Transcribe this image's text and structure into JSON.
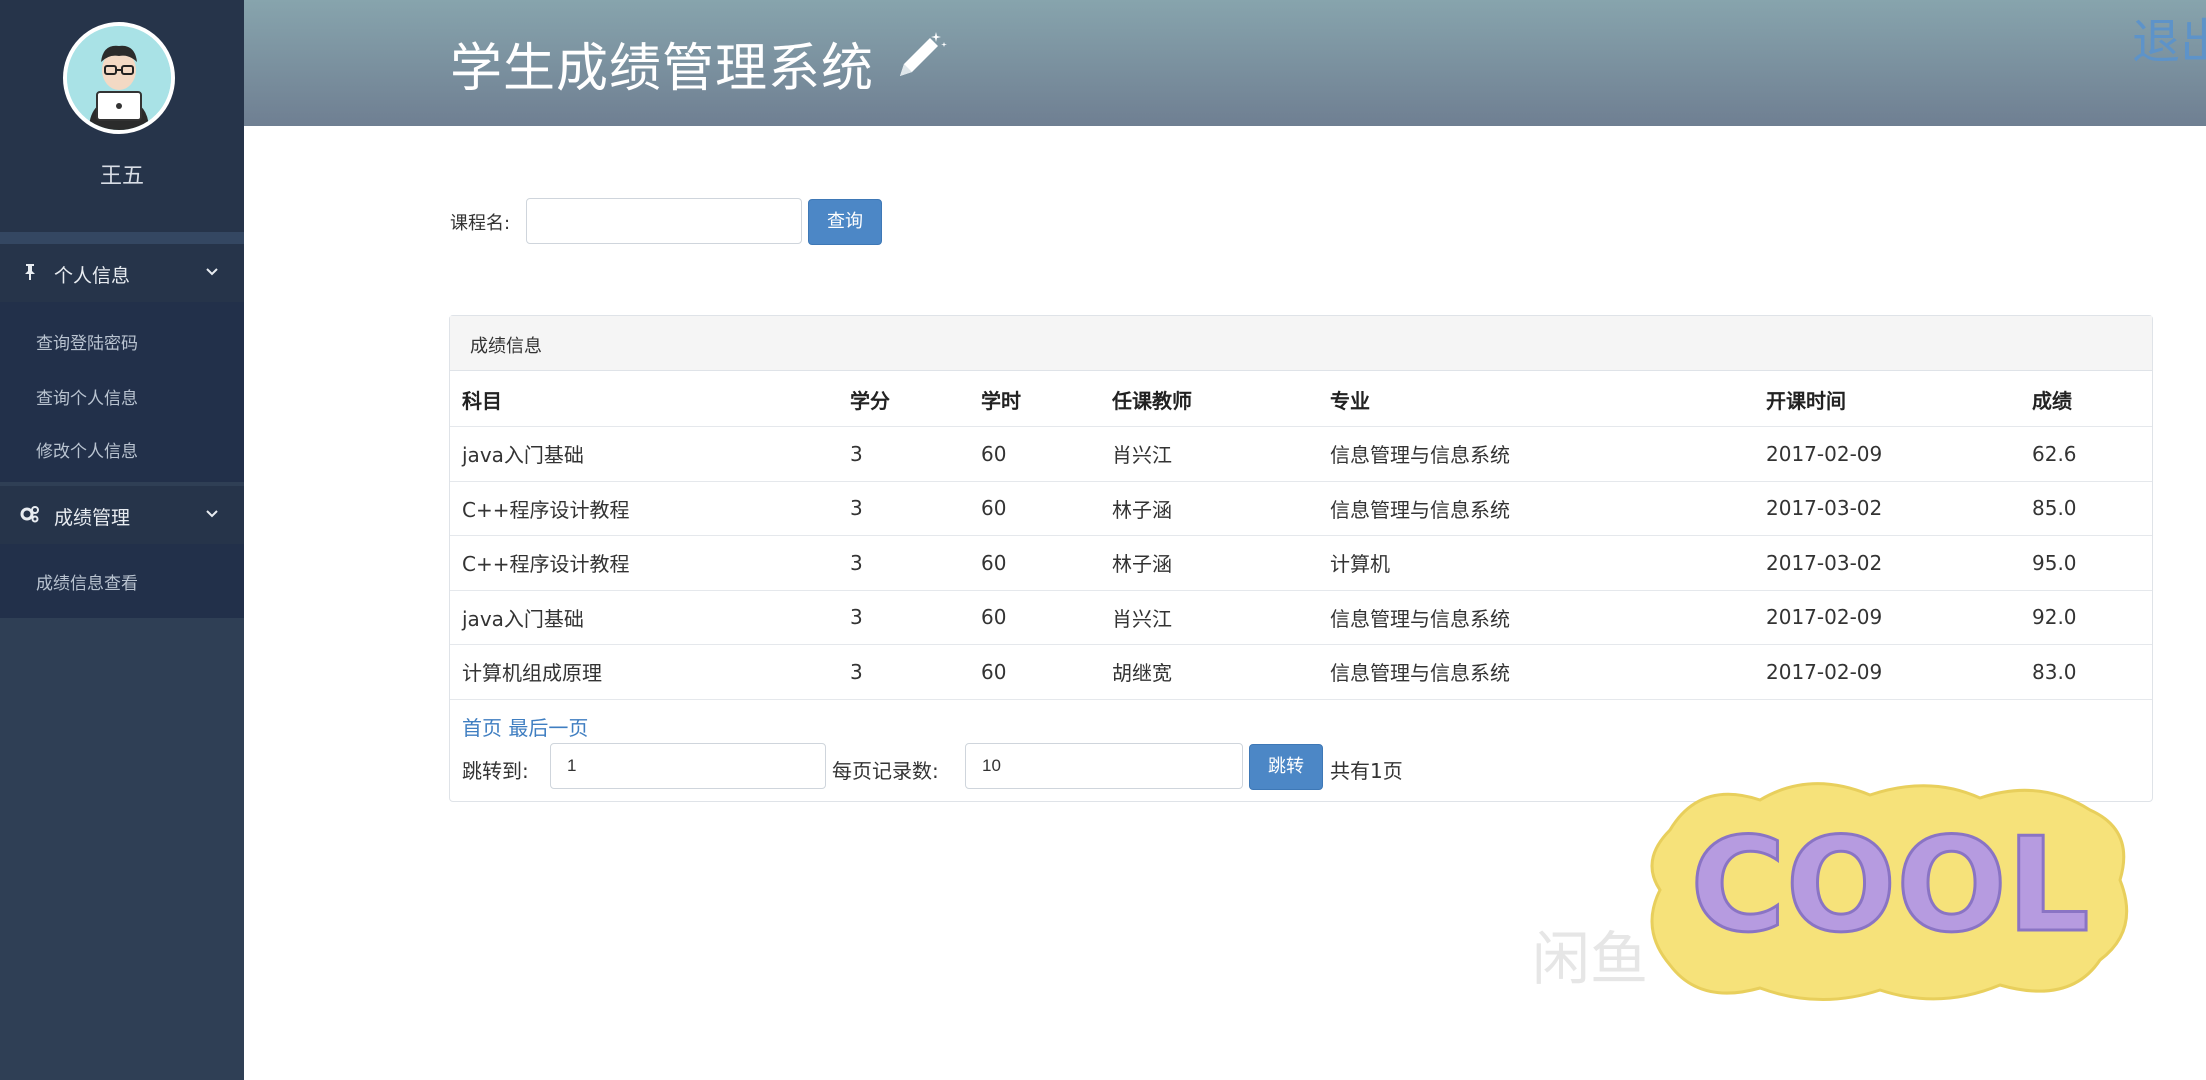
{
  "sidebar": {
    "user_name": "王五",
    "groups": [
      {
        "label": "个人信息",
        "items": [
          "查询登陆密码",
          "查询个人信息",
          "修改个人信息"
        ]
      },
      {
        "label": "成绩管理",
        "items": [
          "成绩信息查看"
        ]
      }
    ]
  },
  "header": {
    "title": "学生成绩管理系统",
    "logout_label": "退出"
  },
  "search": {
    "label": "课程名:",
    "value": "",
    "button": "查询"
  },
  "panel": {
    "title": "成绩信息",
    "columns": [
      "科目",
      "学分",
      "学时",
      "任课教师",
      "专业",
      "开课时间",
      "成绩"
    ],
    "rows": [
      [
        "java入门基础",
        "3",
        "60",
        "肖兴江",
        "信息管理与信息系统",
        "2017-02-09",
        "62.6"
      ],
      [
        "C++程序设计教程",
        "3",
        "60",
        "林子涵",
        "信息管理与信息系统",
        "2017-03-02",
        "85.0"
      ],
      [
        "C++程序设计教程",
        "3",
        "60",
        "林子涵",
        "计算机",
        "2017-03-02",
        "95.0"
      ],
      [
        "java入门基础",
        "3",
        "60",
        "肖兴江",
        "信息管理与信息系统",
        "2017-02-09",
        "92.0"
      ],
      [
        "计算机组成原理",
        "3",
        "60",
        "胡继宽",
        "信息管理与信息系统",
        "2017-02-09",
        "83.0"
      ]
    ]
  },
  "pagination": {
    "first": "首页",
    "last": "最后一页",
    "jump_label": "跳转到:",
    "jump_value": "1",
    "per_page_label": "每页记录数:",
    "per_page_value": "10",
    "jump_button": "跳转",
    "total_pages": "共有1页"
  },
  "watermark": {
    "text": "闲鱼",
    "sticker_text": "COOL"
  },
  "colors": {
    "sidebar": "#2f3f55",
    "accent": "#4c87c6",
    "header_top": "#87a4ad",
    "header_bottom": "#6f7f92"
  }
}
